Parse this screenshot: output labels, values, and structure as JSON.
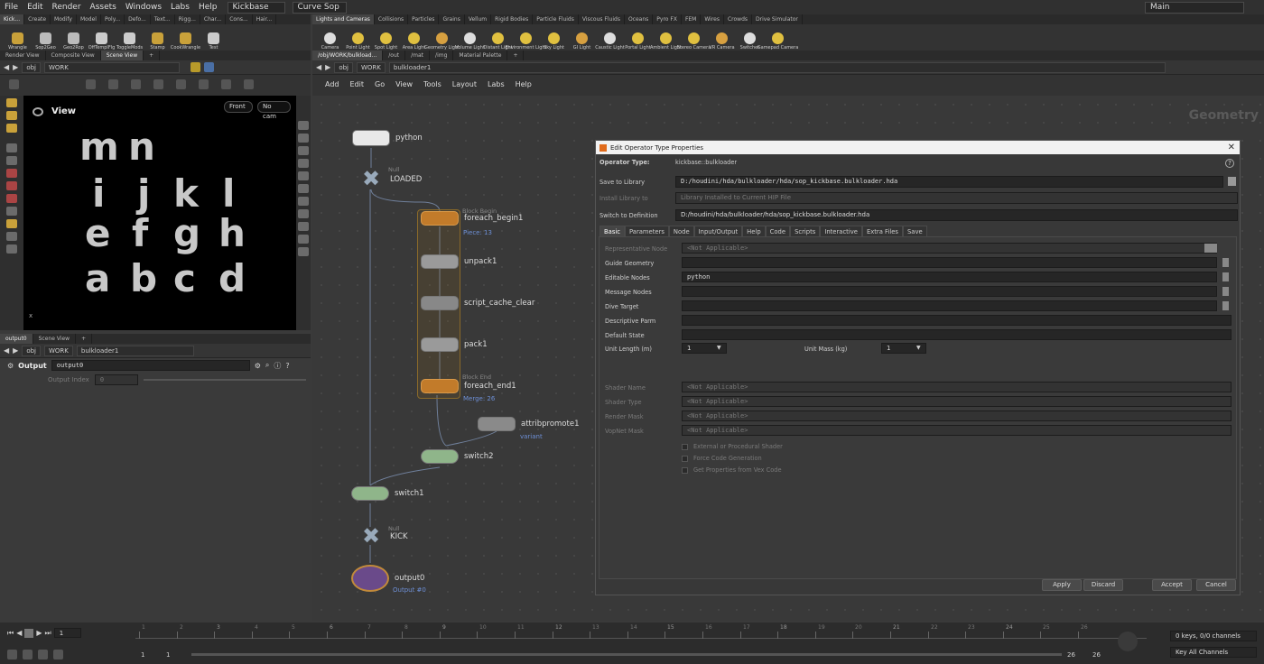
{
  "menubar": {
    "items": [
      "File",
      "Edit",
      "Render",
      "Assets",
      "Windows",
      "Labs",
      "Help"
    ],
    "desktop": "Kickbase",
    "context": "Curve Sop",
    "main": "Main"
  },
  "shelf_left": {
    "tabs": [
      "Kick...",
      "Create",
      "Modify",
      "Model",
      "Poly...",
      "Defo...",
      "Text...",
      "Rigg...",
      "Char...",
      "Cons...",
      "Hair..."
    ],
    "tools": [
      "Wrangle",
      "Sop2Geo",
      "Geo2Rop",
      "OffTemplFlg",
      "ToggleMods",
      "Stamp",
      "CookWrangle",
      "Test"
    ]
  },
  "shelf_right": {
    "tabs": [
      "Lights and Cameras",
      "Collisions",
      "Particles",
      "Grains",
      "Vellum",
      "Rigid Bodies",
      "Particle Fluids",
      "Viscous Fluids",
      "Oceans",
      "Pyro FX",
      "FEM",
      "Wires",
      "Crowds",
      "Drive Simulator"
    ],
    "tools": [
      "Camera",
      "Point Light",
      "Spot Light",
      "Area Light",
      "Geometry Light",
      "Volume Light",
      "Distant Light",
      "Environment Light",
      "Sky Light",
      "GI Light",
      "Caustic Light",
      "Portal Light",
      "Ambient Light",
      "Stereo Camera",
      "VR Camera",
      "Switcher",
      "Gamepad Camera"
    ]
  },
  "left_panes": {
    "tabs": [
      "Render View",
      "Composite View",
      "Scene View"
    ],
    "path": [
      "obj",
      "WORK"
    ]
  },
  "viewport": {
    "title": "View",
    "cam_front": "Front",
    "cam_no": "No cam",
    "glyphs": [
      "m",
      "n",
      "i",
      "j",
      "k",
      "l",
      "e",
      "f",
      "g",
      "h",
      "a",
      "b",
      "c",
      "d"
    ]
  },
  "param_pane": {
    "tabs": [
      "output0",
      "Scene View"
    ],
    "path": [
      "obj",
      "WORK",
      "bulkloader1"
    ],
    "label": "Output",
    "name": "output0",
    "field_label": "Output Index",
    "field_value": "0"
  },
  "net_tabs": [
    "/obj/WORK/bulkload...",
    "/out",
    "/mat",
    "/img",
    "Material Palette"
  ],
  "net_path": [
    "obj",
    "WORK",
    "bulkloader1"
  ],
  "net_menu": [
    "Add",
    "Edit",
    "Go",
    "View",
    "Tools",
    "Layout",
    "Labs",
    "Help"
  ],
  "net_watermark": "Geometry",
  "nodes": {
    "python": "python",
    "loaded_type": "Null",
    "loaded": "LOADED",
    "fb_type": "Block Begin",
    "foreach_begin": "foreach_begin1",
    "fb_sub": "Piece: 13",
    "unpack": "unpack1",
    "scc": "script_cache_clear",
    "pack": "pack1",
    "fe_type": "Block End",
    "foreach_end": "foreach_end1",
    "fe_sub": "Merge: 26",
    "attrib": "attribpromote1",
    "attrib_sub": "variant",
    "switch2": "switch2",
    "switch1": "switch1",
    "kick_type": "Null",
    "kick": "KICK",
    "output": "output0",
    "output_sub": "Output #0"
  },
  "dialog": {
    "title": "Edit Operator Type Properties",
    "op_type_label": "Operator Type:",
    "op_type": "kickbase::bulkloader",
    "save_label": "Save to Library",
    "save_value": "D:/houdini/hda/bulkloader/hda/sop_kickbase.bulkloader.hda",
    "install_label": "Install Library to",
    "install_value": "Library Installed to Current HIP File",
    "switch_label": "Switch to Definition",
    "switch_value": "D:/houdini/hda/bulkloader/hda/sop_kickbase.bulkloader.hda",
    "tabs": [
      "Basic",
      "Parameters",
      "Node",
      "Input/Output",
      "Help",
      "Code",
      "Scripts",
      "Interactive",
      "Extra Files",
      "Save"
    ],
    "na": "<Not Applicable>",
    "rows": [
      "Representative Node",
      "Guide Geometry",
      "Editable Nodes",
      "Message Nodes",
      "Dive Target",
      "Descriptive Parm",
      "Default State"
    ],
    "editable_value": "python",
    "unit_length_label": "Unit Length (m)",
    "unit_length": "1",
    "unit_mass_label": "Unit Mass (kg)",
    "unit_mass": "1",
    "shader_rows": [
      "Shader Name",
      "Shader Type",
      "Render Mask",
      "VopNet Mask"
    ],
    "checks": [
      "External or Procedural Shader",
      "Force Code Generation",
      "Get Properties from Vex Code"
    ],
    "buttons": [
      "Apply",
      "Discard",
      "Accept",
      "Cancel"
    ]
  },
  "timeline": {
    "frame": "1",
    "ticks": [
      "1",
      "2",
      "3",
      "4",
      "5",
      "6",
      "7",
      "8",
      "9",
      "10",
      "11",
      "12",
      "13",
      "14",
      "15",
      "16",
      "17",
      "18",
      "19",
      "20",
      "21",
      "22",
      "23",
      "24",
      "25",
      "26"
    ],
    "start": "1",
    "start2": "1",
    "end": "26",
    "end2": "26",
    "keys": "0 keys, 0/0 channels",
    "key_all": "Key All Channels"
  }
}
